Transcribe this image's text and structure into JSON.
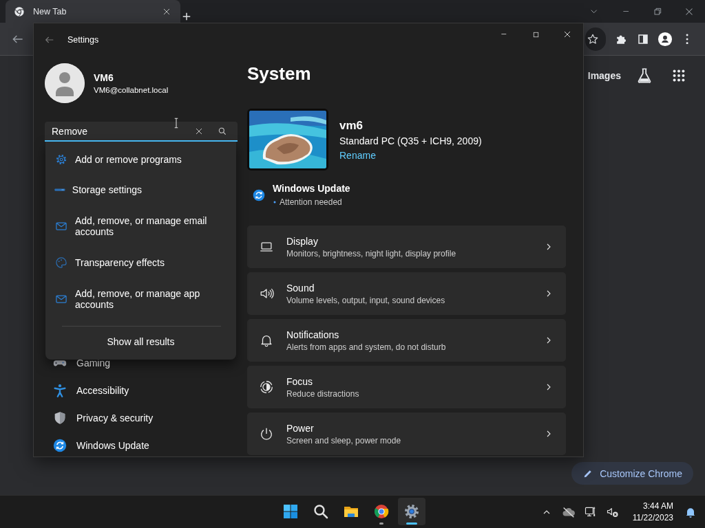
{
  "browser": {
    "tab": {
      "title": "New Tab"
    },
    "links": [
      "Images"
    ],
    "customize_button": "Customize Chrome"
  },
  "settings": {
    "title": "Settings",
    "user": {
      "name": "VM6",
      "email": "VM6@collabnet.local"
    },
    "search": {
      "value": "Remove"
    },
    "search_results": [
      {
        "label": "Add or remove programs",
        "kind": "gear"
      },
      {
        "label": "Storage settings",
        "kind": "storage"
      },
      {
        "label": "Add, remove, or manage email accounts",
        "kind": "mail"
      },
      {
        "label": "Transparency effects",
        "kind": "palette"
      },
      {
        "label": "Add, remove, or manage app accounts",
        "kind": "mail"
      }
    ],
    "show_all": "Show all results",
    "nav_items": [
      {
        "label": "Gaming",
        "kind": "gamepad"
      },
      {
        "label": "Accessibility",
        "kind": "accessibility"
      },
      {
        "label": "Privacy & security",
        "kind": "shield"
      },
      {
        "label": "Windows Update",
        "kind": "update"
      }
    ],
    "page_title": "System",
    "device": {
      "name": "vm6",
      "model": "Standard PC (Q35 + ICH9, 2009)",
      "rename": "Rename"
    },
    "update": {
      "title": "Windows Update",
      "status": "Attention needed"
    },
    "cards": [
      {
        "title": "Display",
        "subtitle": "Monitors, brightness, night light, display profile",
        "kind": "laptop"
      },
      {
        "title": "Sound",
        "subtitle": "Volume levels, output, input, sound devices",
        "kind": "speaker"
      },
      {
        "title": "Notifications",
        "subtitle": "Alerts from apps and system, do not disturb",
        "kind": "bell"
      },
      {
        "title": "Focus",
        "subtitle": "Reduce distractions",
        "kind": "focus"
      },
      {
        "title": "Power",
        "subtitle": "Screen and sleep, power mode",
        "kind": "power"
      }
    ]
  },
  "taskbar": {
    "apps": [
      {
        "kind": "start",
        "running": false,
        "selected": false
      },
      {
        "kind": "search",
        "running": false,
        "selected": false
      },
      {
        "kind": "folder",
        "running": false,
        "selected": false
      },
      {
        "kind": "browser",
        "running": true,
        "selected": false
      },
      {
        "kind": "settings",
        "running": true,
        "selected": true
      }
    ],
    "time": "3:44 AM",
    "date": "11/22/2023"
  }
}
